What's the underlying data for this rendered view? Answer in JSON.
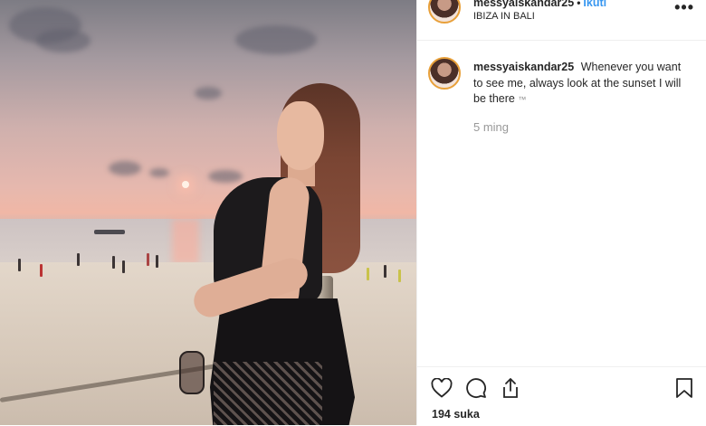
{
  "post": {
    "username": "messyaiskandar25",
    "follow_label": "Ikuti",
    "location": "IBIZA IN BALI",
    "more_label": "•••",
    "caption": {
      "username": "messyaiskandar25",
      "text": "Whenever you want to see me, always look at the sunset I will be there",
      "emoji": "™"
    },
    "time_ago": "5 ming",
    "likes_text": "194 suka"
  },
  "icons": {
    "like": "heart-icon",
    "comment": "comment-icon",
    "share": "share-icon",
    "save": "bookmark-icon"
  },
  "colors": {
    "follow": "#3897f0",
    "avatar_ring": "#e8a03a",
    "text": "#262626",
    "muted": "#999999"
  }
}
